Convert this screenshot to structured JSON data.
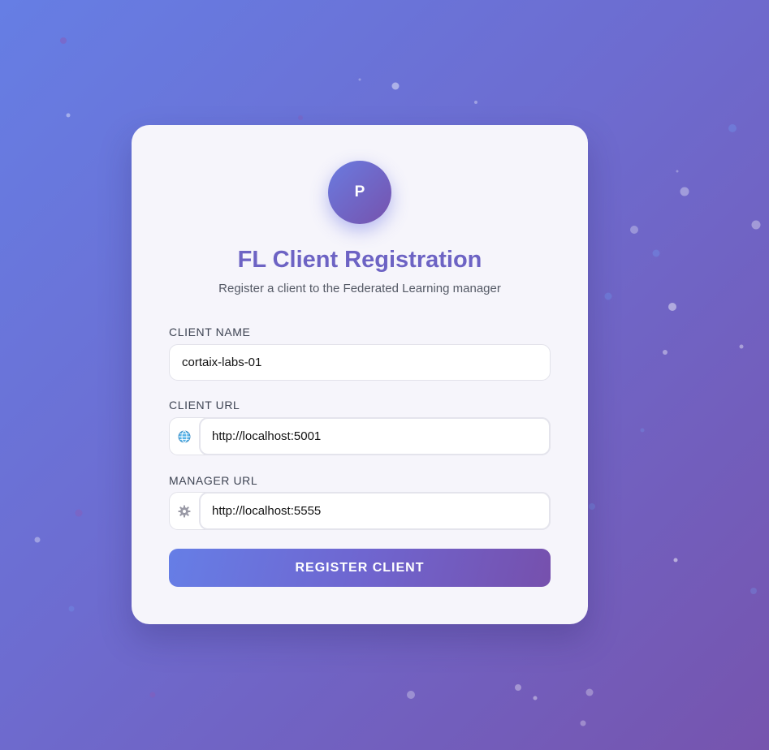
{
  "logo": {
    "letter": "P"
  },
  "header": {
    "title": "FL Client Registration",
    "subtitle": "Register a client to the Federated Learning manager"
  },
  "form": {
    "client_name": {
      "label": "CLIENT NAME",
      "value": "cortaix-labs-01",
      "icon": "none"
    },
    "client_url": {
      "label": "CLIENT URL",
      "value": "http://localhost:5001",
      "icon": "globe-icon"
    },
    "manager_url": {
      "label": "MANAGER URL",
      "value": "http://localhost:5555",
      "icon": "gear-icon"
    },
    "submit_label": "REGISTER CLIENT"
  },
  "colors": {
    "background_start": "#667ee4",
    "background_end": "#7654ae",
    "card": "#f6f5fb",
    "title": "#6d63c4",
    "accent_start": "#667ee6",
    "accent_end": "#7650ad"
  }
}
